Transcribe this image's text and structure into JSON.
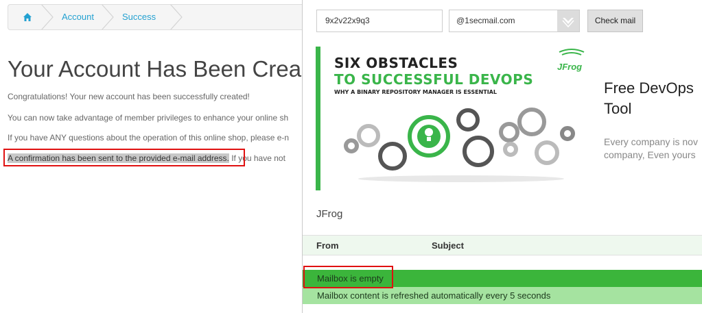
{
  "shop": {
    "breadcrumb": {
      "home_icon": "home-icon",
      "items": [
        "Account",
        "Success"
      ]
    },
    "title": "Your Account Has Been Crea",
    "paragraphs": [
      "Congratulations! Your new account has been successfully created!",
      "You can now take advantage of member privileges to enhance your online sh",
      "If you have ANY questions about the operation of this online shop, please e-n",
      "A confirmation has been sent to the provided e-mail address.",
      " If you have not"
    ]
  },
  "mail": {
    "username_value": "9x2v22x9q3",
    "domain_value": "@1secmail.com",
    "domain_arrow_icon": "chevron-down-icon",
    "check_button": "Check mail",
    "ad": {
      "image_line1": "SIX OBSTACLES",
      "image_line2": "TO SUCCESSFUL DEVOPS",
      "image_line3": "WHY A BINARY REPOSITORY MANAGER IS ESSENTIAL",
      "logo_text": "JFrog",
      "title_line1": "Free DevOps",
      "title_line2": "Tool",
      "desc_line1": "Every company is nov",
      "desc_line2": "company, Even yours",
      "sponsor": "JFrog"
    },
    "table": {
      "col_from": "From",
      "col_subject": "Subject",
      "empty_text": "Mailbox is empty",
      "refresh_text": "Mailbox content is refreshed automatically every 5 seconds"
    }
  },
  "colors": {
    "link": "#23a1d1",
    "highlight_box": "#e01010",
    "green": "#3bb53b",
    "light_green": "#a5e3a0"
  }
}
